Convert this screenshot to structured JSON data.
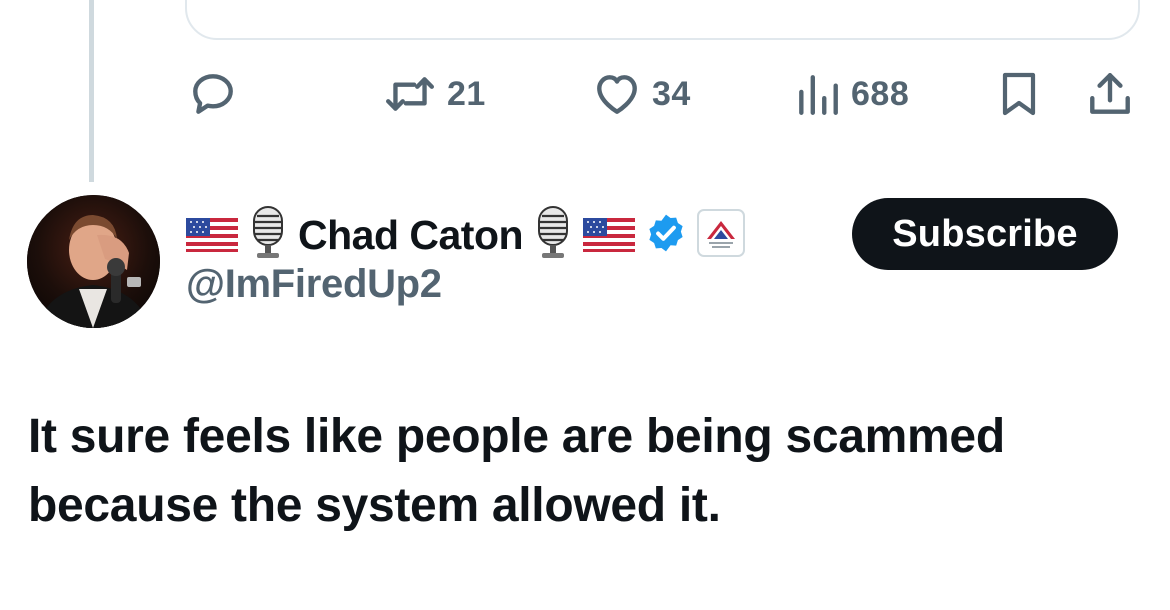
{
  "thread": {
    "reply_count": "",
    "retweet_count": "21",
    "like_count": "34",
    "view_count": "688"
  },
  "author": {
    "display_name": "Chad Caton",
    "handle": "@ImFiredUp2",
    "prefix_icons": [
      "us-flag-icon",
      "microphone-icon"
    ],
    "suffix_icons": [
      "microphone-icon",
      "us-flag-icon",
      "verified-badge-icon",
      "affiliate-badge-icon"
    ]
  },
  "subscribe_label": "Subscribe",
  "tweet": {
    "text": "It sure feels like people are being scammed because the system allowed it."
  },
  "colors": {
    "icon_gray": "#536471",
    "verified_blue": "#1d9bf0",
    "button_dark": "#0f1419",
    "thread_line": "#cfd9de"
  }
}
